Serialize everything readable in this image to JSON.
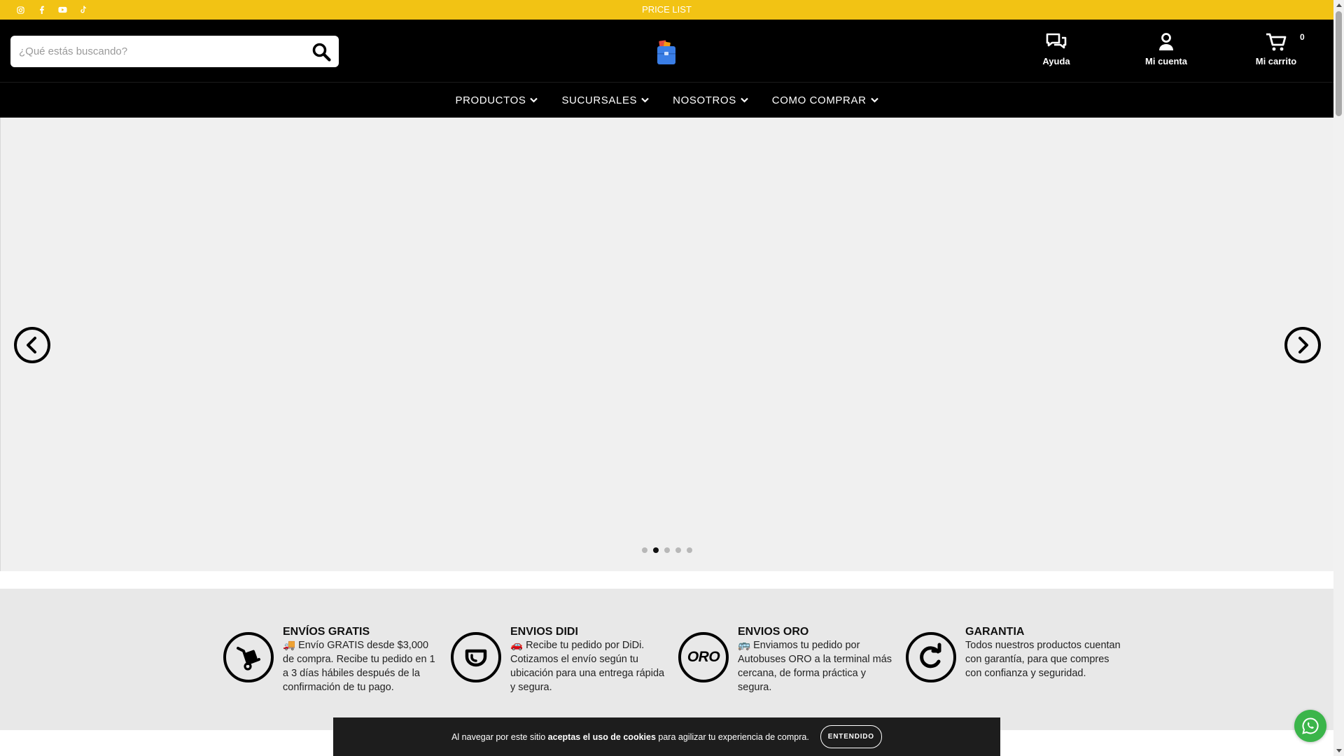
{
  "topbar": {
    "center_link": "PRICE LIST",
    "social_icons": [
      "instagram-icon",
      "facebook-icon",
      "youtube-icon",
      "tiktok-icon"
    ],
    "background_color": "#f2c314"
  },
  "header": {
    "search": {
      "placeholder": "¿Qué estás buscando?",
      "value": ""
    },
    "actions": {
      "help_label": "Ayuda",
      "account_label": "Mi cuenta",
      "cart_label": "Mi carrito",
      "cart_count": "0"
    }
  },
  "nav": {
    "items": [
      {
        "label": "PRODUCTOS"
      },
      {
        "label": "SUCURSALES"
      },
      {
        "label": "NOSOTROS"
      },
      {
        "label": "COMO COMPRAR"
      }
    ]
  },
  "carousel": {
    "slide_count": 5,
    "active_slide": 2
  },
  "features": [
    {
      "title": "ENVÍOS GRATIS",
      "description": "🚚 Envío GRATIS desde $3,000 de compra. Recibe tu pedido en 1 a 3 días hábiles después de la confirmación de tu pago.",
      "icon": "hand-truck-icon"
    },
    {
      "title": "ENVIOS DIDI",
      "description": "🚗 Recibe tu pedido por DiDi. Cotizamos el envío según tu ubicación para una entrega rápida y segura.",
      "icon": "didi-icon"
    },
    {
      "title": "ENVIOS ORO",
      "description": "🚌 Enviamos tu pedido por Autobuses ORO a la terminal más cercana, de forma práctica y segura.",
      "icon": "oro-logo-icon",
      "icon_text": "ORO"
    },
    {
      "title": "GARANTIA",
      "description": "Todos nuestros productos cuentan con garantía, para que compres con confianza y seguridad.",
      "icon": "refresh-icon"
    }
  ],
  "cookie": {
    "text_before": "Al navegar por este sitio ",
    "text_bold": "aceptas el uso de cookies",
    "text_after": " para agilizar tu experiencia de compra.",
    "button_label": "ENTENDIDO"
  },
  "colors": {
    "accent_yellow": "#f2c314",
    "header_black": "#000000",
    "whatsapp_green": "#3bb54a"
  }
}
